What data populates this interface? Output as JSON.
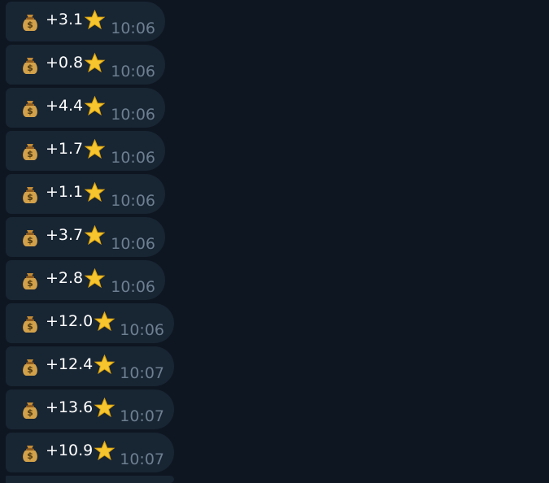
{
  "chat": {
    "messages": [
      {
        "amount": "+3.1",
        "time": "10:06"
      },
      {
        "amount": "+0.8",
        "time": "10:06"
      },
      {
        "amount": "+4.4",
        "time": "10:06"
      },
      {
        "amount": "+1.7",
        "time": "10:06"
      },
      {
        "amount": "+1.1",
        "time": "10:06"
      },
      {
        "amount": "+3.7",
        "time": "10:06"
      },
      {
        "amount": "+2.8",
        "time": "10:06"
      },
      {
        "amount": "+12.0",
        "time": "10:06"
      },
      {
        "amount": "+12.4",
        "time": "10:07"
      },
      {
        "amount": "+13.6",
        "time": "10:07"
      },
      {
        "amount": "+10.9",
        "time": "10:07"
      }
    ],
    "icons": {
      "prefix": "money-bag-icon",
      "suffix": "star-icon"
    },
    "colors": {
      "background": "#0e1621",
      "bubble": "#182533",
      "text": "#ffffff",
      "time": "#6d7f91",
      "star": "#f7c62f",
      "bag": "#d2a14a"
    }
  }
}
